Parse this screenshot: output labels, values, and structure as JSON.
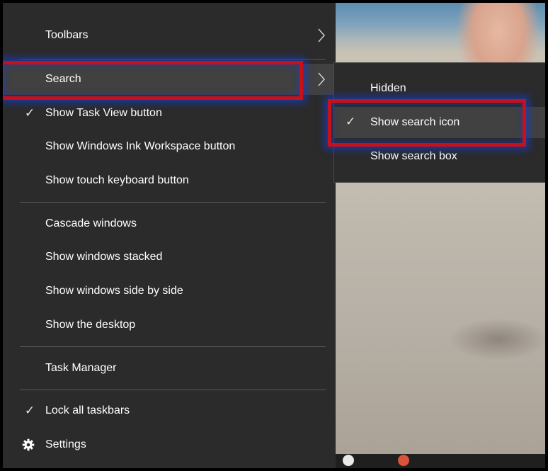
{
  "menu": {
    "items": [
      {
        "label": "Toolbars",
        "checked": false,
        "submenu": true
      },
      {
        "label": "Search",
        "checked": false,
        "submenu": true,
        "highlighted": true
      },
      {
        "label": "Show Task View button",
        "checked": true
      },
      {
        "label": "Show Windows Ink Workspace button",
        "checked": false
      },
      {
        "label": "Show touch keyboard button",
        "checked": false
      },
      {
        "label": "Cascade windows",
        "checked": false
      },
      {
        "label": "Show windows stacked",
        "checked": false
      },
      {
        "label": "Show windows side by side",
        "checked": false
      },
      {
        "label": "Show the desktop",
        "checked": false
      },
      {
        "label": "Task Manager",
        "checked": false
      },
      {
        "label": "Lock all taskbars",
        "checked": true
      },
      {
        "label": "Settings",
        "icon": "gear-icon"
      }
    ],
    "check_glyph": "✓"
  },
  "search_submenu": {
    "items": [
      {
        "label": "Hidden",
        "checked": false
      },
      {
        "label": "Show search icon",
        "checked": true,
        "highlighted": true
      },
      {
        "label": "Show search box",
        "checked": false
      }
    ]
  },
  "colors": {
    "menu_bg": "#2b2b2b",
    "hover_bg": "#414141",
    "highlight_border": "#c8101a",
    "highlight_glow": "#1e3cc8"
  }
}
